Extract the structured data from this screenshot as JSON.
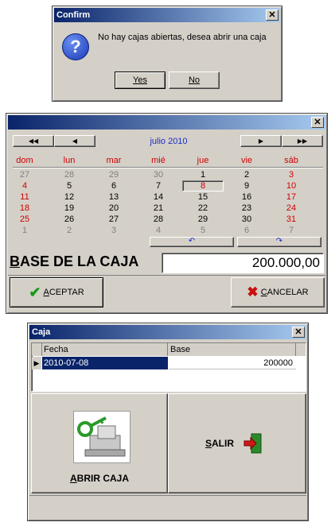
{
  "confirm": {
    "title": "Confirm",
    "close": "✕",
    "message": "No hay cajas abiertas, desea abrir una caja",
    "yes": "Yes",
    "no": "No"
  },
  "calendar_dialog": {
    "close": "✕",
    "month_label": "julio 2010",
    "nav": {
      "prev_year": "◀◀",
      "prev_month": "◀",
      "next_month": "▶",
      "next_year": "▶▶"
    },
    "weekdays": [
      "dom",
      "lun",
      "mar",
      "mié",
      "jue",
      "vie",
      "sáb"
    ],
    "weeks": [
      [
        "27",
        "28",
        "29",
        "30",
        "1",
        "2",
        "3"
      ],
      [
        "4",
        "5",
        "6",
        "7",
        "8",
        "9",
        "10"
      ],
      [
        "11",
        "12",
        "13",
        "14",
        "15",
        "16",
        "17"
      ],
      [
        "18",
        "19",
        "20",
        "21",
        "22",
        "23",
        "24"
      ],
      [
        "25",
        "26",
        "27",
        "28",
        "29",
        "30",
        "31"
      ],
      [
        "1",
        "2",
        "3",
        "4",
        "5",
        "6",
        "7"
      ]
    ],
    "selected_day": "8",
    "base_label": "BASE DE LA CAJA",
    "base_value": "200.000,00",
    "accept_label": "ACEPTAR",
    "cancel_label": "CANCELAR"
  },
  "caja": {
    "title": "Caja",
    "close": "✕",
    "columns": [
      "Fecha",
      "Base"
    ],
    "rows": [
      {
        "fecha": "2010-07-08",
        "base": "200000"
      }
    ],
    "open_label": "ABRIR CAJA",
    "exit_label": "SALIR"
  }
}
